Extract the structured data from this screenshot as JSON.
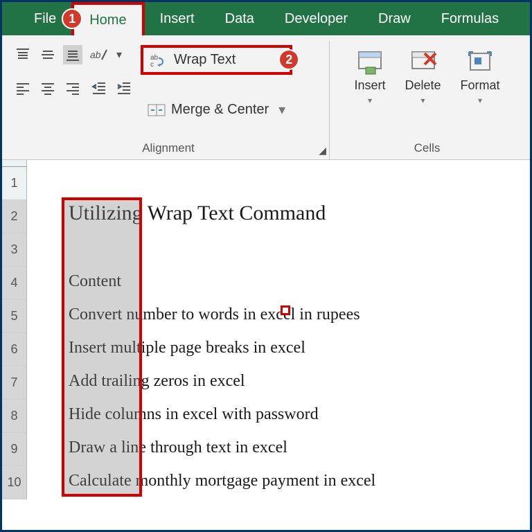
{
  "tabs": {
    "file": "File",
    "home": "Home",
    "insert": "Insert",
    "data": "Data",
    "developer": "Developer",
    "draw": "Draw",
    "formulas": "Formulas"
  },
  "annotations": {
    "one": "1",
    "two": "2"
  },
  "ribbon": {
    "alignment": {
      "title": "Alignment",
      "wrap_text": "Wrap Text",
      "merge_center": "Merge & Center"
    },
    "cells": {
      "title": "Cells",
      "insert": "Insert",
      "delete": "Delete",
      "format": "Format"
    }
  },
  "rows": {
    "r1": "1",
    "r2": "2",
    "r3": "3",
    "r4": "4",
    "r5": "5",
    "r6": "6",
    "r7": "7",
    "r8": "8",
    "r9": "9",
    "r10": "10"
  },
  "sheet": {
    "title": "Utilizing Wrap Text Command",
    "r4": "Content",
    "r5": "Convert number to words in excel in rupees",
    "r6": "Insert multiple page breaks in excel",
    "r7": "Add trailing zeros in excel",
    "r8": "Hide columns in excel with password",
    "r9": "Draw a line through text in excel",
    "r10": "Calculate monthly mortgage payment in excel"
  }
}
